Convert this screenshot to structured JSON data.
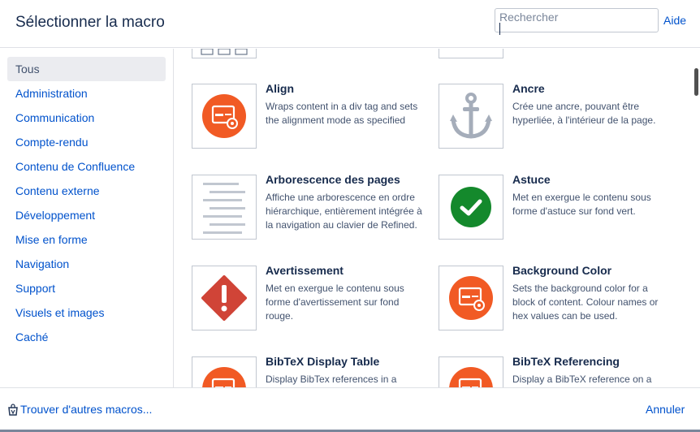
{
  "header": {
    "title": "Sélectionner la macro",
    "search_placeholder": "Rechercher",
    "help_label": "Aide"
  },
  "sidebar": {
    "items": [
      {
        "label": "Tous",
        "active": true
      },
      {
        "label": "Administration"
      },
      {
        "label": "Communication"
      },
      {
        "label": "Compte-rendu"
      },
      {
        "label": "Contenu de Confluence"
      },
      {
        "label": "Contenu externe"
      },
      {
        "label": "Développement"
      },
      {
        "label": "Mise en forme"
      },
      {
        "label": "Navigation"
      },
      {
        "label": "Support"
      },
      {
        "label": "Visuels et images"
      },
      {
        "label": "Caché"
      }
    ]
  },
  "macros": [
    {
      "name": "Align",
      "description": "Wraps content in a div tag and sets the alignment mode as specified",
      "icon": "plugin-gear-icon"
    },
    {
      "name": "Ancre",
      "description": "Crée une ancre, pouvant être hyperliée, à l'intérieur de la page.",
      "icon": "anchor-icon"
    },
    {
      "name": "Arborescence des pages",
      "description": "Affiche une arborescence en ordre hiérarchique, entièrement intégrée à la navigation au clavier de Refined.",
      "icon": "text-lines-icon"
    },
    {
      "name": "Astuce",
      "description": "Met en exergue le contenu sous forme d'astuce sur fond vert.",
      "icon": "check-circle-icon"
    },
    {
      "name": "Avertissement",
      "description": "Met en exergue le contenu sous forme d'avertissement sur fond rouge.",
      "icon": "warning-icon"
    },
    {
      "name": "Background Color",
      "description": "Sets the background color for a block of content. Colour names or hex values can be used.",
      "icon": "plugin-gear-icon"
    },
    {
      "name": "BibTeX Display Table",
      "description": "Display BibTex references in a",
      "icon": "plugin-gear-icon"
    },
    {
      "name": "BibTeX Referencing",
      "description": "Display a BibTeX reference on a",
      "icon": "plugin-gear-icon"
    }
  ],
  "footer": {
    "more_macros_label": "Trouver d'autres macros...",
    "cancel_label": "Annuler"
  },
  "colors": {
    "plugin_orange": "#f15a24",
    "success_green": "#14892c",
    "error_red": "#d04437",
    "link_blue": "#0052cc"
  }
}
